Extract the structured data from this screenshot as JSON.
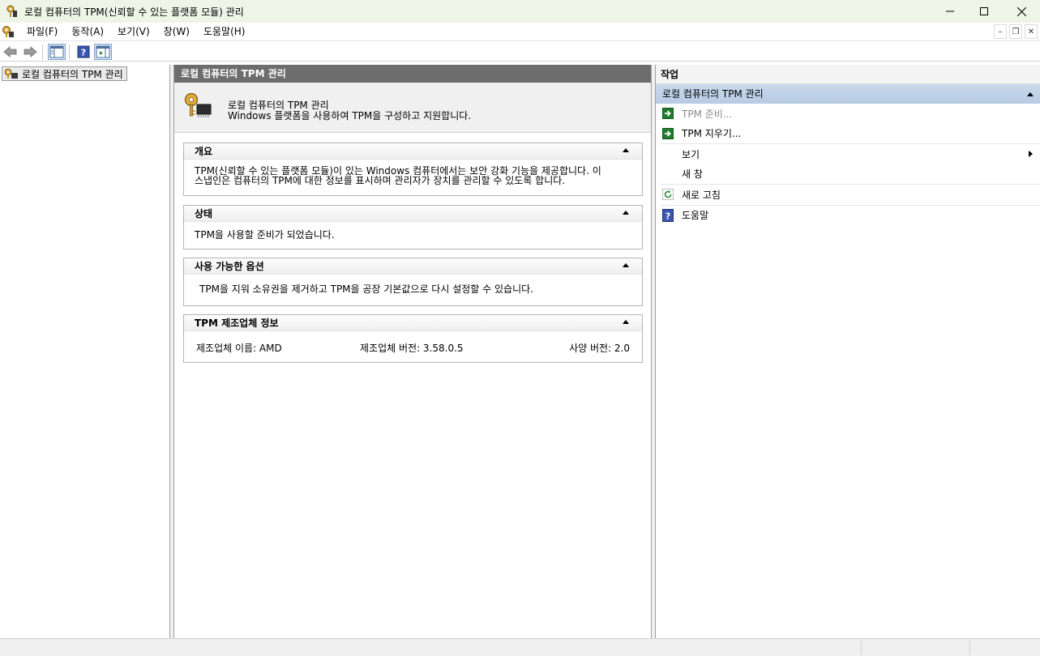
{
  "window": {
    "title": "로컬 컴퓨터의 TPM(신뢰할 수 있는 플랫폼 모듈) 관리",
    "controls": {
      "minimize": "—",
      "maximize": "☐",
      "close": "✕"
    }
  },
  "menu": {
    "items": [
      {
        "label": "파일(F)"
      },
      {
        "label": "동작(A)"
      },
      {
        "label": "보기(V)"
      },
      {
        "label": "창(W)"
      },
      {
        "label": "도움말(H)"
      }
    ],
    "mdi": {
      "minimize": "–",
      "restore": "❐",
      "close": "✕"
    }
  },
  "toolbar": {
    "icons": [
      "back-icon",
      "forward-icon",
      "show-hide-tree-icon",
      "help-icon",
      "show-hide-action-pane-icon"
    ]
  },
  "tree": {
    "root_label": "로컬 컴퓨터의 TPM 관리"
  },
  "center": {
    "header": "로컬 컴퓨터의 TPM 관리",
    "hero": {
      "line1": "로컬 컴퓨터의 TPM 관리",
      "line2": "Windows 플랫폼을 사용하여 TPM을 구성하고 지원합니다."
    },
    "sections": {
      "overview": {
        "title": "개요",
        "line1": "TPM(신뢰할 수 있는 플랫폼 모듈)이 있는 Windows 컴퓨터에서는 보안 강화 기능을 제공합니다. 이",
        "line2": "스냅인은 컴퓨터의 TPM에 대한 정보를 표시하며 관리자가 장치를 관리할 수 있도록 합니다."
      },
      "status": {
        "title": "상태",
        "text": "TPM을 사용할 준비가 되었습니다."
      },
      "options": {
        "title": "사용 가능한 옵션",
        "text": "TPM을 지워 소유권을 제거하고 TPM을 공장 기본값으로 다시 설정할 수 있습니다."
      },
      "manufacturer": {
        "title": "TPM 제조업체 정보",
        "name": "제조업체 이름: AMD",
        "version": "제조업체 버전: 3.58.0.5",
        "spec": "사양 버전: 2.0"
      }
    }
  },
  "actions": {
    "header": "작업",
    "group_label": "로컬 컴퓨터의 TPM 관리",
    "items": [
      {
        "label": "TPM 준비...",
        "icon": "green-arrow-icon",
        "enabled": false
      },
      {
        "label": "TPM 지우기...",
        "icon": "green-arrow-icon",
        "enabled": true
      },
      {
        "label": "보기",
        "icon": "",
        "enabled": true,
        "submenu": true
      },
      {
        "label": "새 창",
        "icon": "",
        "enabled": true
      },
      {
        "label": "새로 고침",
        "icon": "refresh-icon",
        "enabled": true
      },
      {
        "label": "도움말",
        "icon": "help-icon",
        "enabled": true
      }
    ]
  },
  "colors": {
    "titlebar_bg": "#eef4e6",
    "pane_header_bg": "#6d6d6d",
    "action_group_bg": "#c3d5ea",
    "action_arrow_green": "#1e7d2a"
  }
}
